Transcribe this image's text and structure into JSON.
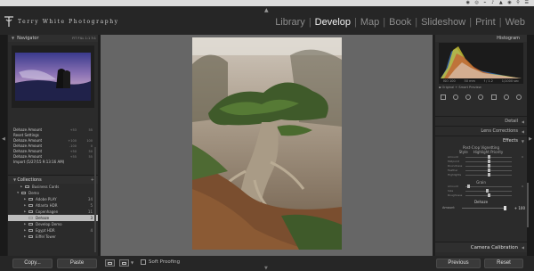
{
  "menubar": {
    "status_icons": "◉ ◎ ⌁ ♪ ▲ ◉ ⚲ ☰"
  },
  "brand": {
    "name": "Terry White Photography"
  },
  "modules": [
    {
      "label": "Library"
    },
    {
      "label": "Develop"
    },
    {
      "label": "Map"
    },
    {
      "label": "Book"
    },
    {
      "label": "Slideshow"
    },
    {
      "label": "Print"
    },
    {
      "label": "Web"
    }
  ],
  "left_panel": {
    "navigator": {
      "title": "Navigator",
      "zoom_options": "FIT  FILL  1:1  3:1"
    },
    "history": [
      {
        "label": "Dehaze Amount",
        "v": "+53",
        "v2": "55"
      },
      {
        "label": "Reset Settings",
        "v": "",
        "v2": ""
      },
      {
        "label": "Dehaze Amount",
        "v": "+100",
        "v2": "100"
      },
      {
        "label": "Dehaze Amount",
        "v": "-100",
        "v2": "0"
      },
      {
        "label": "Dehaze Amount",
        "v": "+50",
        "v2": "50"
      },
      {
        "label": "Dehaze Amount",
        "v": "+55",
        "v2": "55"
      },
      {
        "label": "Import (5/27/15 9:13:16 AM)",
        "v": "",
        "v2": ""
      }
    ],
    "collections": {
      "title": "Collections",
      "add": "+",
      "items": [
        {
          "label": "Business Cards",
          "count": "",
          "indent": 2
        },
        {
          "label": "Demo",
          "count": "",
          "indent": 1
        },
        {
          "label": "Adobe PLAY",
          "count": "34",
          "indent": 3
        },
        {
          "label": "Atlanta HDR",
          "count": "5",
          "indent": 3
        },
        {
          "label": "Copenhagen",
          "count": "11",
          "indent": 3
        },
        {
          "label": "Dehaze",
          "count": "3",
          "indent": 3,
          "selected": true
        },
        {
          "label": "Develop Demo",
          "count": "",
          "indent": 3
        },
        {
          "label": "Egypt HDR",
          "count": "4",
          "indent": 3
        },
        {
          "label": "Eiffel Tower",
          "count": "",
          "indent": 3
        }
      ]
    }
  },
  "right_panel": {
    "histogram": {
      "title": "Histogram",
      "iso": "ISO 100",
      "focal": "50 mm",
      "aperture": "f / 1.2",
      "shutter": "1/1000 sec",
      "preview": "Original + Smart Preview"
    },
    "sections": {
      "detail": "Detail",
      "lens": "Lens Corrections",
      "effects": "Effects"
    },
    "vignetting": {
      "title": "Post-Crop Vignetting",
      "style_label": "Style",
      "style_value": "Highlight Priority",
      "sliders": [
        {
          "label": "Amount",
          "value": "0",
          "pos": 0.5
        },
        {
          "label": "Midpoint",
          "value": "",
          "pos": 0.5
        },
        {
          "label": "Roundness",
          "value": "",
          "pos": 0.5
        },
        {
          "label": "Feather",
          "value": "",
          "pos": 0.5
        },
        {
          "label": "Highlights",
          "value": "",
          "pos": 0.5
        }
      ]
    },
    "grain": {
      "title": "Grain",
      "sliders": [
        {
          "label": "Amount",
          "value": "0",
          "pos": 0.05
        },
        {
          "label": "Size",
          "value": "",
          "pos": 0.45
        },
        {
          "label": "Roughness",
          "value": "",
          "pos": 0.5
        }
      ]
    },
    "dehaze": {
      "title": "Dehaze",
      "amount_label": "Amount",
      "amount_value": "+ 100",
      "amount_level": 1.0
    },
    "camera_calibration": "Camera Calibration"
  },
  "bottom": {
    "copy": "Copy...",
    "paste": "Paste",
    "soft_proofing": "Soft Proofing",
    "previous": "Previous",
    "reset": "Reset"
  }
}
